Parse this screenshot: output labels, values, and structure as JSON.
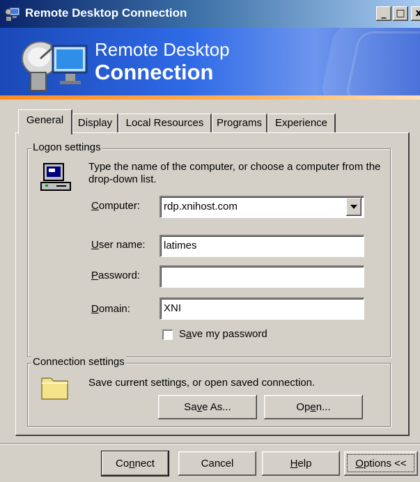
{
  "window": {
    "title": "Remote Desktop Connection",
    "controls": {
      "minimize": "_",
      "maximize": "□",
      "close": "x"
    }
  },
  "banner": {
    "line1": "Remote Desktop",
    "line2": "Connection"
  },
  "tabs": [
    {
      "label": "General",
      "active": true
    },
    {
      "label": "Display",
      "active": false
    },
    {
      "label": "Local Resources",
      "active": false
    },
    {
      "label": "Programs",
      "active": false
    },
    {
      "label": "Experience",
      "active": false
    }
  ],
  "logon": {
    "legend": "Logon settings",
    "instruction": "Type the name of the computer, or choose a computer from the drop-down list.",
    "computer": {
      "label_pre": "",
      "label_key": "C",
      "label_post": "omputer:",
      "value": "rdp.xnihost.com"
    },
    "username": {
      "label_pre": "",
      "label_key": "U",
      "label_post": "ser name:",
      "value": "latimes"
    },
    "password": {
      "label_pre": "",
      "label_key": "P",
      "label_post": "assword:",
      "value": ""
    },
    "domain": {
      "label_pre": "",
      "label_key": "D",
      "label_post": "omain:",
      "value": "XNI"
    },
    "save_password": {
      "label_pre": "S",
      "label_key": "a",
      "label_post": "ve my password",
      "checked": false
    }
  },
  "connection": {
    "legend": "Connection settings",
    "description": "Save current settings, or open saved connection.",
    "save_as": {
      "pre": "Sa",
      "key": "v",
      "post": "e As..."
    },
    "open": {
      "pre": "Op",
      "key": "e",
      "post": "n..."
    }
  },
  "footer": {
    "connect": {
      "pre": "Co",
      "key": "n",
      "post": "nect"
    },
    "cancel": "Cancel",
    "help": {
      "pre": "",
      "key": "H",
      "post": "elp"
    },
    "options": {
      "pre": "",
      "key": "O",
      "post": "ptions <<"
    }
  },
  "colors": {
    "accent_orange": "#ff8a1c",
    "banner_blue": "#2f6ae6",
    "titlebar_blue": "#0a246a"
  }
}
